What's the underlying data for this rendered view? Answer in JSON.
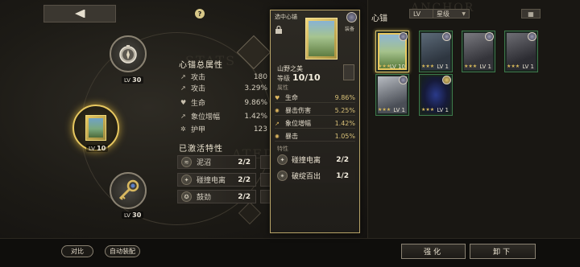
{
  "watermarks": [
    "STATS",
    "ATED",
    "ANCHOR"
  ],
  "help_label": "?",
  "slots": [
    {
      "name": "compass",
      "lv_prefix": "LV",
      "lv": "30"
    },
    {
      "name": "card",
      "lv_prefix": "LV",
      "lv": "10"
    },
    {
      "name": "key",
      "lv_prefix": "LV",
      "lv": "30"
    }
  ],
  "stats_panel": {
    "title": "心锚总属性",
    "stats": [
      {
        "icon": "↗",
        "label": "攻击",
        "value": "180"
      },
      {
        "icon": "↗",
        "label": "攻击",
        "value": "3.29%"
      },
      {
        "icon": "♥",
        "label": "生命",
        "value": "9.86%"
      },
      {
        "icon": "↗",
        "label": "象位增幅",
        "value": "1.42%"
      },
      {
        "icon": "✲",
        "label": "护甲",
        "value": "123"
      }
    ],
    "traits_title": "已激活特性",
    "traits": [
      {
        "icon": "≋",
        "name": "泥沼",
        "count": "2/2"
      },
      {
        "icon": "✦",
        "name": "碰撞电离",
        "count": "2/2"
      },
      {
        "icon": "✪",
        "name": "鼓劲",
        "count": "2/2"
      }
    ]
  },
  "detail": {
    "header": "选中心锚",
    "equip_label": "装备",
    "name": "山野之美",
    "level_label": "等级",
    "level_value": "10/10",
    "attr_title": "属性",
    "attrs": [
      {
        "icon": "♥",
        "label": "生命",
        "value": "9.86%"
      },
      {
        "icon": "✺",
        "label": "暴击伤害",
        "value": "5.25%"
      },
      {
        "icon": "↗",
        "label": "象位增幅",
        "value": "1.42%"
      },
      {
        "icon": "✺",
        "label": "暴击",
        "value": "1.05%"
      }
    ],
    "trait_title": "特性",
    "traits": [
      {
        "icon": "✦",
        "name": "碰撞电离",
        "count": "2/2"
      },
      {
        "icon": "✴",
        "name": "破绽百出",
        "count": "1/2"
      }
    ]
  },
  "inventory": {
    "title": "心锚",
    "filter_lv": "LV",
    "filter_star": "星级",
    "grid_icon": "▦",
    "cards": [
      {
        "lv_label": "LV",
        "lv": "10",
        "stars": "★★★",
        "selected": true
      },
      {
        "lv_label": "LV",
        "lv": "1",
        "stars": "★★★",
        "selected": false
      },
      {
        "lv_label": "LV",
        "lv": "1",
        "stars": "★★★",
        "selected": false
      },
      {
        "lv_label": "LV",
        "lv": "1",
        "stars": "★★★",
        "selected": false
      },
      {
        "lv_label": "LV",
        "lv": "1",
        "stars": "★★★",
        "selected": false
      },
      {
        "lv_label": "LV",
        "lv": "1",
        "stars": "★★★",
        "selected": false
      }
    ]
  },
  "bottom": {
    "compare": "对比",
    "auto_equip": "自动装配",
    "upgrade": "强化",
    "unequip": "卸下"
  }
}
